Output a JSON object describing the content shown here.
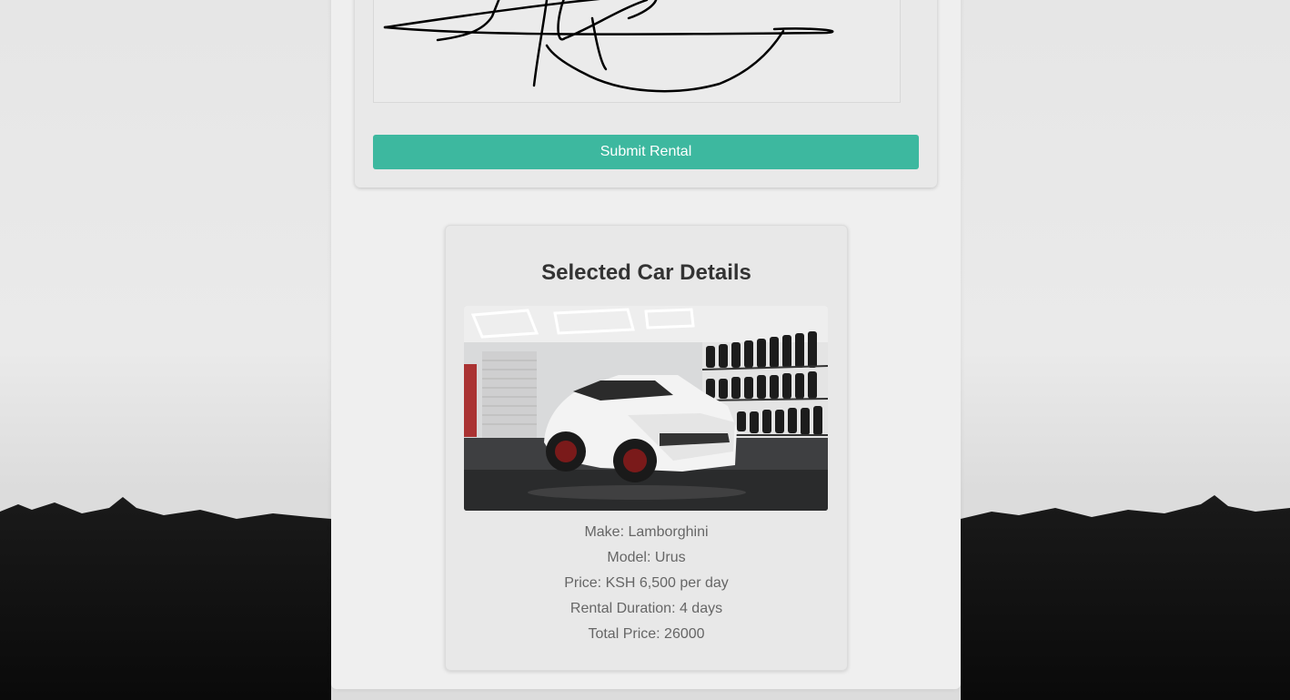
{
  "form": {
    "submit_label": "Submit Rental"
  },
  "details": {
    "title": "Selected Car Details",
    "make": "Make: Lamborghini",
    "model": "Model: Urus",
    "price": "Price: KSH 6,500 per day",
    "duration": "Rental Duration: 4 days",
    "total": "Total Price: 26000"
  },
  "colors": {
    "accent": "#3db89f",
    "card_bg": "#e8e8e8",
    "text_muted": "#666666"
  }
}
